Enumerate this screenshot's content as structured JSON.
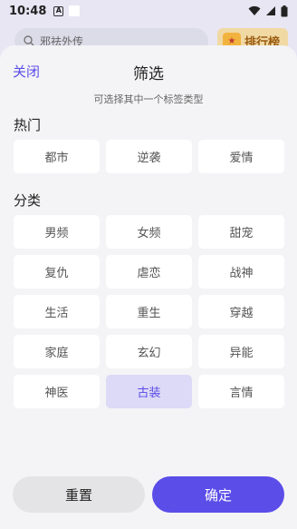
{
  "status_bar": {
    "time": "10:48",
    "badge_letter": "A"
  },
  "background": {
    "search_placeholder": "邪祛外传",
    "rank_label": "排行榜"
  },
  "sheet": {
    "close_label": "关闭",
    "title": "筛选",
    "subtitle": "可选择其中一个标签类型",
    "hot_title": "热门",
    "hot_tags": [
      "都市",
      "逆袭",
      "爱情"
    ],
    "category_title": "分类",
    "category_tags": [
      "男频",
      "女频",
      "甜宠",
      "复仇",
      "虐恋",
      "战神",
      "生活",
      "重生",
      "穿越",
      "家庭",
      "玄幻",
      "异能",
      "神医",
      "古装",
      "言情"
    ],
    "selected_tag": "古装",
    "reset_label": "重置",
    "confirm_label": "确定"
  },
  "colors": {
    "accent": "#5b4de8",
    "selected_bg": "#dcdaf6",
    "sheet_bg": "#f4f4f6"
  }
}
